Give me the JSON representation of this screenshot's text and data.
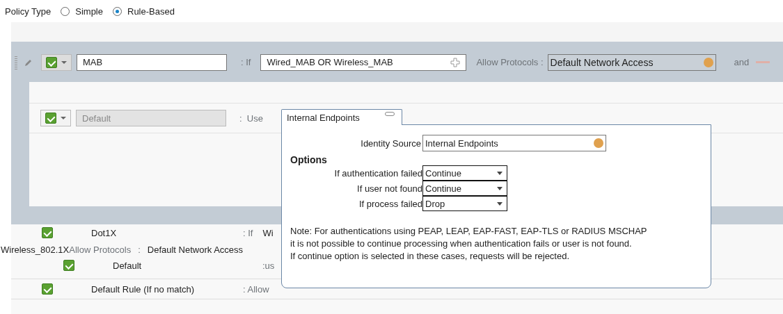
{
  "policy_type": {
    "label": "Policy Type",
    "options": [
      {
        "label": "Simple",
        "selected": false
      },
      {
        "label": "Rule-Based",
        "selected": true
      }
    ]
  },
  "rule": {
    "checked": true,
    "name": "MAB",
    "if_label": ": If",
    "condition": "Wired_MAB OR Wireless_MAB",
    "protocols_label": "Allow Protocols :",
    "protocols": "Default Network Access",
    "and_label": "and"
  },
  "inner_rule": {
    "checked": true,
    "name": "Default",
    "use_label": ":  Use"
  },
  "popup": {
    "tab": "Internal Endpoints",
    "identity_label": "Identity Source",
    "identity_value": "Internal Endpoints",
    "options_heading": "Options",
    "options": [
      {
        "label": "If authentication failed",
        "value": "Continue"
      },
      {
        "label": "If user not found",
        "value": "Continue"
      },
      {
        "label": "If process failed",
        "value": "Drop"
      }
    ],
    "note": [
      "Note: For authentications using PEAP, LEAP, EAP-FAST, EAP-TLS or RADIUS MSCHAP",
      "it is not possible to continue processing when authentication fails or user is not found.",
      "If continue option is selected in these cases, requests will be rejected."
    ]
  },
  "dot1x": {
    "checked": true,
    "name": "Dot1X",
    "if_label": ": If",
    "condition": "Wi",
    "condition_end": "Wireless_802.1X",
    "protocols_label": "Allow Protocols",
    "separator": ":",
    "protocols": "Default Network Access",
    "sub_checked": true,
    "sub_name": "Default",
    "sub_use": ":us"
  },
  "default_rule": {
    "checked": true,
    "name": "Default Rule (If no match)",
    "protocols_label": ": Allow"
  }
}
